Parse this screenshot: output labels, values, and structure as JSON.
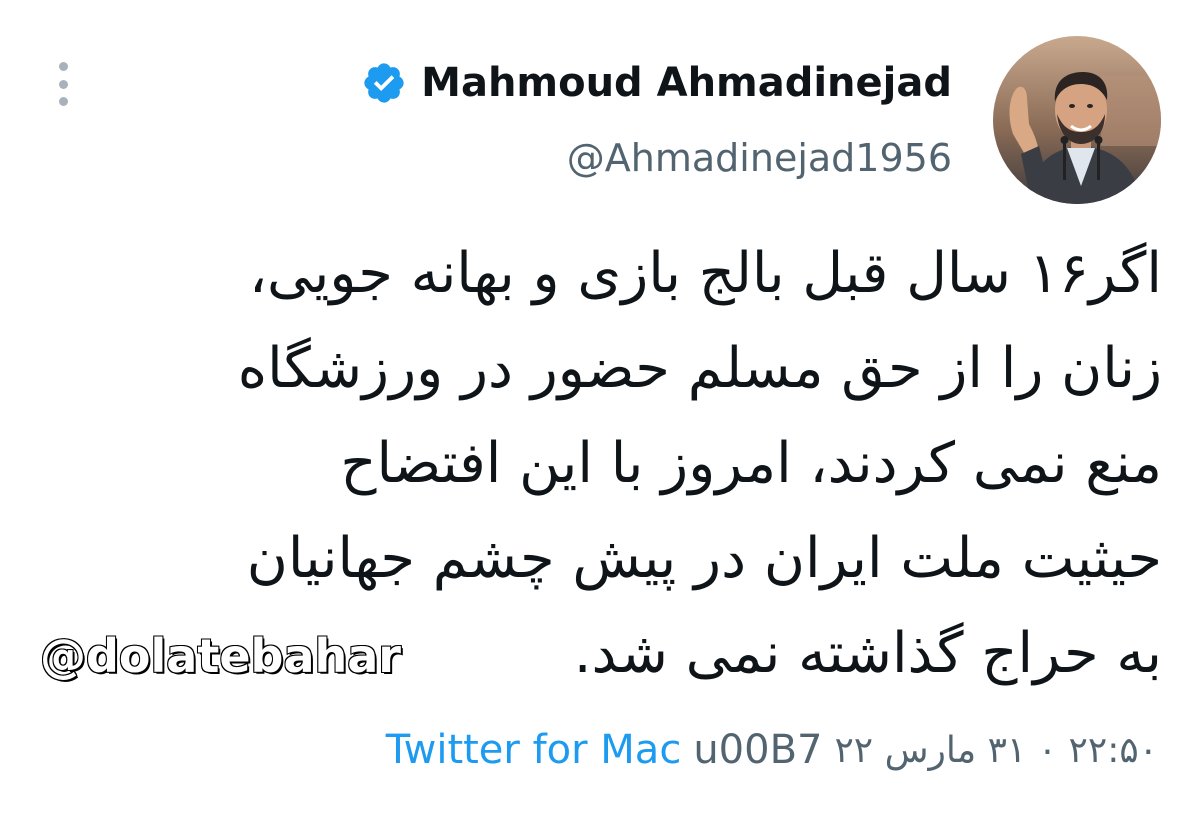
{
  "tweet": {
    "author": {
      "display_name": "Mahmoud Ahmadinejad",
      "handle": "@Ahmadinejad1956",
      "verified": true,
      "avatar_icon": "person-waving-avatar"
    },
    "text_lines": [
      "اگر۱۶ سال قبل بالج بازی و بهانه جویی،",
      "زنان را از حق مسلم حضور در ورزشگاه",
      "منع نمی کردند، امروز با این افتضاح",
      "حیثیت ملت ایران در پیش چشم جهانیان",
      "به حراج گذاشته نمی شد."
    ],
    "watermark": "@dolatebahar",
    "timestamp": "۲۲:۵۰ ۰ ۳۱ مارس ۲۲",
    "separator": "u00B7",
    "source": "Twitter for Mac",
    "more_icon": "more-vertical-icon",
    "verified_icon": "verified-badge-icon"
  },
  "colors": {
    "text_primary": "#0f1419",
    "text_secondary": "#536471",
    "link": "#1d9bf0",
    "verified": "#1d9bf0",
    "more_dots": "#a9b2ba"
  }
}
